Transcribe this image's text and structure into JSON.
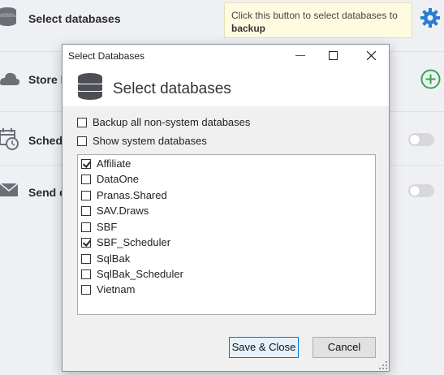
{
  "background": {
    "rows": [
      {
        "label": "Select databases",
        "icon": "database-icon"
      },
      {
        "label": "Store b",
        "icon": "cloud-icon",
        "action_icon": "add-circle-icon"
      },
      {
        "label": "Schedu",
        "icon": "calendar-clock-icon"
      },
      {
        "label": "Send c",
        "icon": "mail-icon"
      }
    ],
    "settings_icon": "gear-icon",
    "accent_green": "#34a853",
    "accent_blue": "#2b7cd3"
  },
  "tooltip": {
    "text_line1": "Click this button to select databases to",
    "text_line2": "backup"
  },
  "dialog": {
    "window_title": "Select Databases",
    "header_title": "Select databases",
    "options": [
      {
        "label": "Backup all non-system databases",
        "checked": false
      },
      {
        "label": "Show system databases",
        "checked": false
      }
    ],
    "databases": [
      {
        "name": "Affiliate",
        "checked": true
      },
      {
        "name": "DataOne",
        "checked": false
      },
      {
        "name": "Pranas.Shared",
        "checked": false
      },
      {
        "name": "SAV.Draws",
        "checked": false
      },
      {
        "name": "SBF",
        "checked": false
      },
      {
        "name": "SBF_Scheduler",
        "checked": true
      },
      {
        "name": "SqlBak",
        "checked": false
      },
      {
        "name": "SqlBak_Scheduler",
        "checked": false
      },
      {
        "name": "Vietnam",
        "checked": false
      }
    ],
    "buttons": {
      "save": "Save & Close",
      "cancel": "Cancel"
    }
  }
}
